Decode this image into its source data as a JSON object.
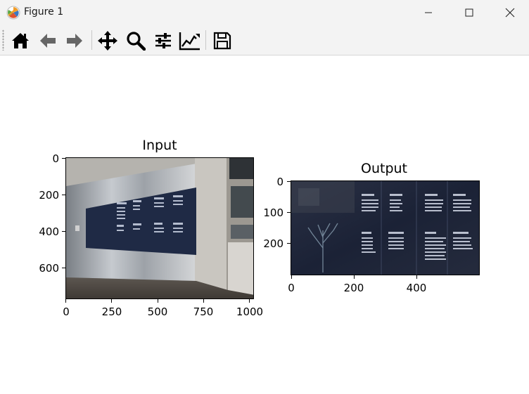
{
  "window": {
    "title": "Figure 1",
    "buttons": [
      "minimize",
      "maximize",
      "close"
    ]
  },
  "toolbar": {
    "tools": [
      {
        "name": "home-icon"
      },
      {
        "name": "back-arrow-icon"
      },
      {
        "name": "forward-arrow-icon"
      },
      {
        "name": "pan-icon"
      },
      {
        "name": "zoom-icon"
      },
      {
        "name": "configure-subplots-icon"
      },
      {
        "name": "edit-axes-icon"
      },
      {
        "name": "save-icon"
      }
    ]
  },
  "figure": {
    "axes": [
      {
        "title": "Input",
        "x_ticks": [
          "0",
          "250",
          "500",
          "750",
          "1000"
        ],
        "y_ticks": [
          "0",
          "200",
          "400",
          "600"
        ]
      },
      {
        "title": "Output",
        "x_ticks": [
          "0",
          "200",
          "400"
        ],
        "y_ticks": [
          "0",
          "100",
          "200"
        ]
      }
    ]
  }
}
